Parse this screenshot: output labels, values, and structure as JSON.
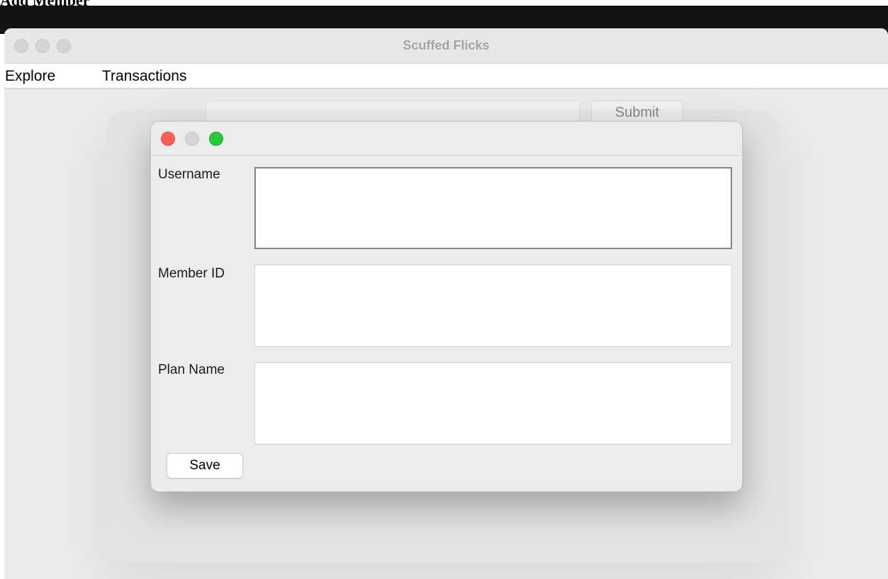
{
  "top_label": "Add Member",
  "app": {
    "title": "Scuffed Flicks"
  },
  "menu": {
    "items": [
      {
        "label": "Explore"
      },
      {
        "label": "Transactions"
      }
    ]
  },
  "background_form": {
    "search_value": "",
    "submit_label": "Submit"
  },
  "dialog": {
    "fields": [
      {
        "label": "Username",
        "value": ""
      },
      {
        "label": "Member ID",
        "value": ""
      },
      {
        "label": "Plan Name",
        "value": ""
      }
    ],
    "save_label": "Save"
  },
  "colors": {
    "close": "#fe5f57",
    "minimize_inactive": "#d6d6d6",
    "maximize": "#28c840",
    "window_bg": "#ebebeb"
  }
}
